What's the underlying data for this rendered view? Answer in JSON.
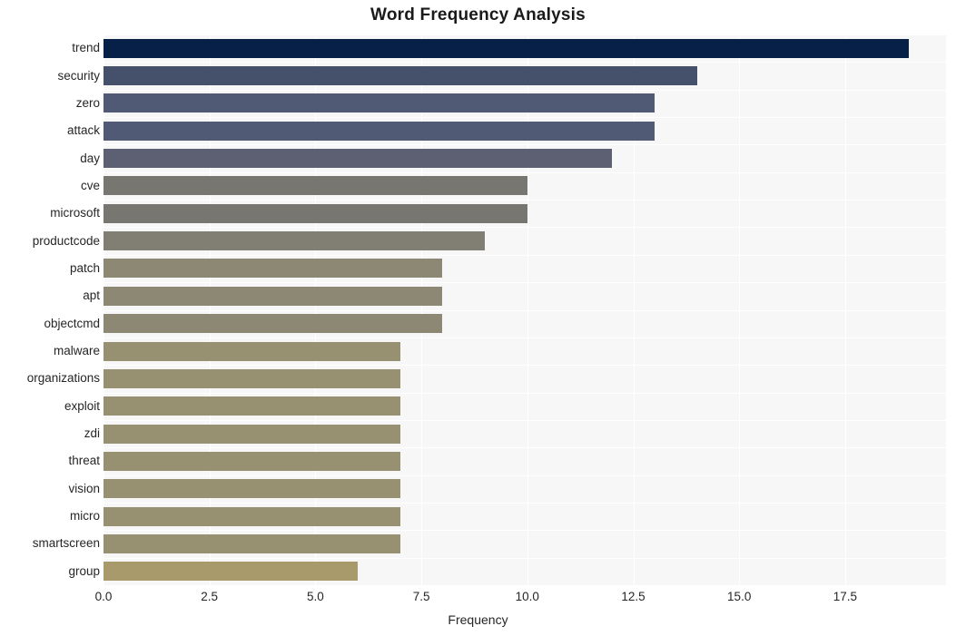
{
  "chart_data": {
    "type": "bar",
    "orientation": "horizontal",
    "title": "Word Frequency Analysis",
    "xlabel": "Frequency",
    "ylabel": "",
    "categories": [
      "trend",
      "security",
      "zero",
      "attack",
      "day",
      "cve",
      "microsoft",
      "productcode",
      "patch",
      "apt",
      "objectcmd",
      "malware",
      "organizations",
      "exploit",
      "zdi",
      "threat",
      "vision",
      "micro",
      "smartscreen",
      "group"
    ],
    "values": [
      19,
      14,
      13,
      13,
      12,
      10,
      10,
      9,
      8,
      8,
      8,
      7,
      7,
      7,
      7,
      7,
      7,
      7,
      7,
      6
    ],
    "xticks": [
      "0.0",
      "2.5",
      "5.0",
      "7.5",
      "10.0",
      "12.5",
      "15.0",
      "17.5"
    ],
    "xtick_values": [
      0,
      2.5,
      5,
      7.5,
      10,
      12.5,
      15,
      17.5
    ],
    "xlim": [
      0,
      19.88
    ],
    "grid": true,
    "legend": false,
    "bar_colors": [
      "#062047",
      "#45506b",
      "#515a74",
      "#515a74",
      "#5c6072",
      "#777671",
      "#777671",
      "#817f74",
      "#8c8874",
      "#8c8874",
      "#8c8874",
      "#979171",
      "#979171",
      "#979171",
      "#979171",
      "#979171",
      "#979171",
      "#979171",
      "#979171",
      "#a89a6b"
    ],
    "plot_background": "#f7f7f7",
    "grid_color": "#ffffff",
    "figure_background": "#ffffff"
  }
}
